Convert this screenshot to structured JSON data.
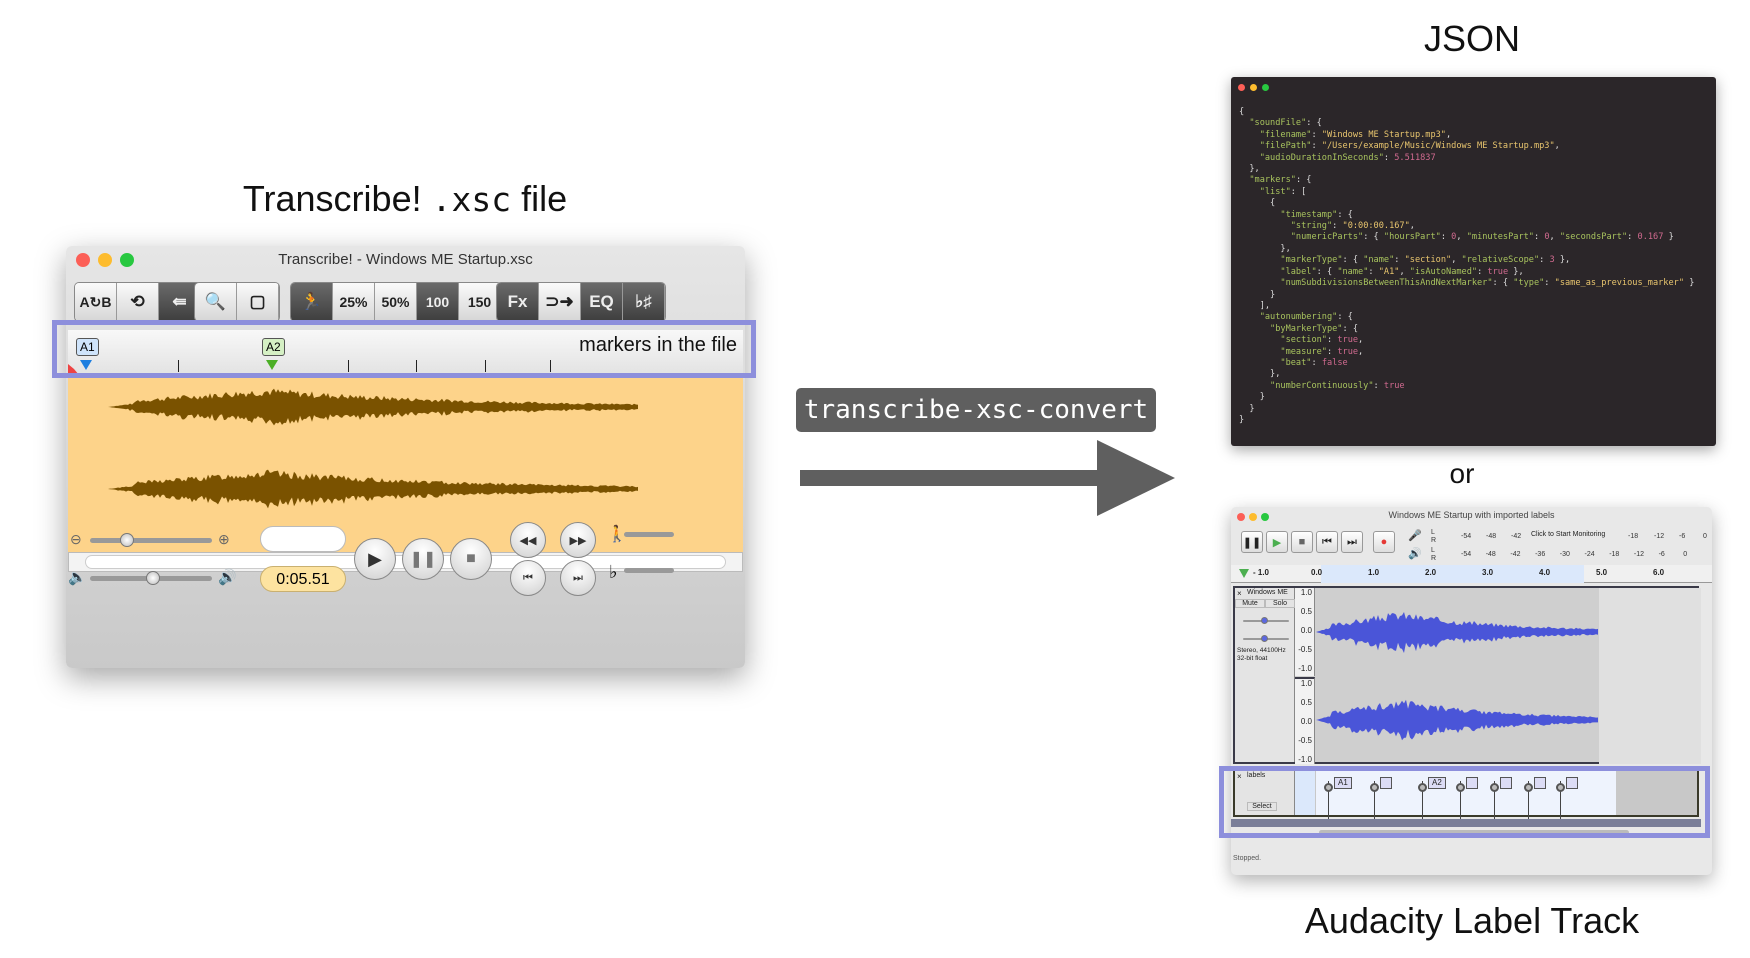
{
  "captions": {
    "left_title_pre": "Transcribe! ",
    "left_title_code": ".xsc",
    "left_title_post": " file",
    "json_title": "JSON",
    "or": "or",
    "audacity_title": "Audacity Label Track"
  },
  "converter": {
    "command": "transcribe-xsc-convert"
  },
  "transcribe": {
    "window_title": "Transcribe! - Windows ME Startup.xsc",
    "toolbar": [
      "A↻B",
      "⟲",
      "⇚",
      "🔍",
      "▢",
      "🏃",
      "25%",
      "50%",
      "100",
      "150",
      "Fx",
      "⊃➜",
      "EQ",
      "♭♯"
    ],
    "markers": [
      {
        "name": "A1",
        "color": "#1e7fe0"
      },
      {
        "name": "A2",
        "color": "#4caf26"
      }
    ],
    "annotation": "markers in the file",
    "time_display": "0:05.51",
    "waveform_color": "#7a5200",
    "waveform_bg": "#fdd38a"
  },
  "json_code": [
    "{",
    "  \"soundFile\": {",
    "    \"filename\": \"Windows ME Startup.mp3\",",
    "    \"filePath\": \"/Users/example/Music/Windows ME Startup.mp3\",",
    "    \"audioDurationInSeconds\": 5.511837",
    "  },",
    "  \"markers\": {",
    "    \"list\": [",
    "      {",
    "        \"timestamp\": {",
    "          \"string\": \"0:00:00.167\",",
    "          \"numericParts\": { \"hoursPart\": 0, \"minutesPart\": 0, \"secondsPart\": 0.167 }",
    "        },",
    "        \"markerType\": { \"name\": \"section\", \"relativeScope\": 3 },",
    "        \"label\": { \"name\": \"A1\", \"isAutoNamed\": true },",
    "        \"numSubdivisionsBetweenThisAndNextMarker\": { \"type\": \"same_as_previous_marker\" }",
    "      }",
    "    ],",
    "    \"autonumbering\": {",
    "      \"byMarkerType\": {",
    "        \"section\": true,",
    "        \"measure\": true,",
    "        \"beat\": false",
    "      },",
    "      \"numberContinuously\": true",
    "    }",
    "  }",
    "}"
  ],
  "audacity": {
    "window_title": "Windows ME Startup with imported labels",
    "monitor_text": "Click to Start Monitoring",
    "rec_meter_ticks": [
      "-54",
      "-48",
      "-42",
      "-18",
      "-12",
      "-6",
      "0"
    ],
    "play_meter_ticks": [
      "-54",
      "-48",
      "-42",
      "-36",
      "-30",
      "-24",
      "-18",
      "-12",
      "-6",
      "0"
    ],
    "timeline": [
      "- 1.0",
      "0.0",
      "1.0",
      "2.0",
      "3.0",
      "4.0",
      "5.0",
      "6.0"
    ],
    "track_name": "Windows ME",
    "mute": "Mute",
    "solo": "Solo",
    "track_info": [
      "Stereo, 44100Hz",
      "32-bit float"
    ],
    "y_axis": [
      "1.0",
      "0.5",
      "0.0",
      "-0.5",
      "-1.0"
    ],
    "label_track_name": "labels",
    "select": "Select",
    "labels": [
      "A1",
      "",
      "A2",
      "",
      "",
      "",
      ""
    ],
    "status": "Stopped.",
    "waveform_color": "#4a55d8"
  }
}
